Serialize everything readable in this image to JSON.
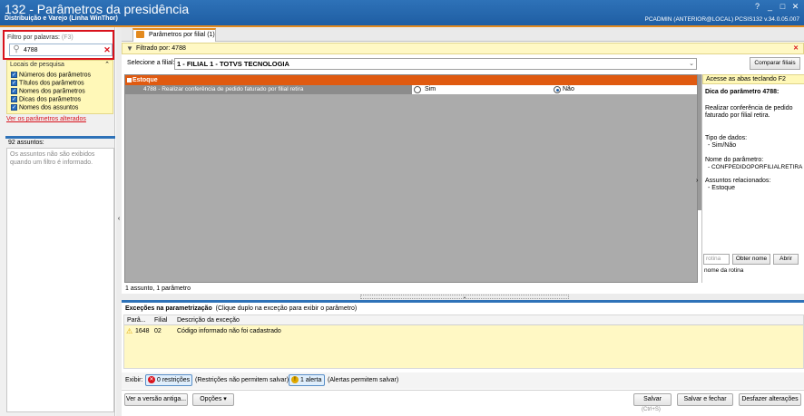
{
  "window": {
    "title": "132 - Parâmetros da presidência",
    "subtitle": "Distribuição e Varejo (Linha WinThor)",
    "user_info": "PCADMIN (ANTERIOR@LOCAL)   PCSIS132  v.34.0.05.007",
    "controls": [
      "?",
      "_",
      "□",
      "✕"
    ]
  },
  "colors": {
    "accent": "#e38a1e",
    "brand_blue": "#1f5ea3",
    "alert_red": "#d9121c",
    "highlight_yellow": "#fff8b8"
  },
  "filter": {
    "label": "Filtro por palavras:",
    "shortcut": "(F3)",
    "value": "4788"
  },
  "search_locations": {
    "title": "Locais de pesquisa",
    "items": [
      "Números dos parâmetros",
      "Títulos dos parâmetros",
      "Nomes dos parâmetros",
      "Dicas dos parâmetros",
      "Nomes dos assuntos"
    ]
  },
  "altered_link": "Ver os parâmetros alterados",
  "subjects": {
    "count": "92 assuntos:",
    "empty_msg": "Os assuntos não são exibidos quando um filtro é informado."
  },
  "tab": {
    "label": "Parâmetros por filial  (1)"
  },
  "filtered": {
    "label": "Filtrado por: 4788"
  },
  "branch": {
    "label": "Selecione a filial:",
    "value": "1 - FILIAL 1 - TOTVS TECNOLOGIA",
    "compare_label": "Comparar filiais"
  },
  "grid": {
    "group": "Estoque",
    "param_label": "4788 - Realizar conferência de pedido faturado por filial retira",
    "option_yes": "Sim",
    "option_no": "Não",
    "selected": "Não"
  },
  "tip": {
    "shortcut": "Acesse as abas teclando F2",
    "title": "Dica do parâmetro 4788:",
    "desc": "Realizar conferência de pedido faturado por filial retira.",
    "type_label": "Tipo de dados:",
    "type_value": "- Sim/Não",
    "name_label": "Nome do parâmetro:",
    "name_value": "- CONFPEDIDOPORFILIALRETIRA",
    "subjects_label": "Assuntos relacionados:",
    "subjects_value": "- Estoque"
  },
  "routine": {
    "placeholder": "rotina",
    "get_name": "Obter nome",
    "open": "Abrir",
    "name_label": "nome da rotina"
  },
  "summary": "1 assunto, 1 parâmetro",
  "exceptions": {
    "title": "Exceções na parametrização",
    "hint": "(Clique duplo na exceção para exibir o parâmetro)",
    "columns": [
      "Parâ...",
      "Filial",
      "Descrição da exceção"
    ],
    "rows": [
      {
        "param": "1648",
        "branch": "02",
        "desc": "Código informado não foi cadastrado"
      }
    ]
  },
  "exibir": {
    "label": "Exibir:",
    "restrictions_btn": "0 restrições",
    "restrictions_note": "(Restrições não permitem salvar)",
    "alerts_btn": "1 alerta",
    "alerts_note": "(Alertas permitem salvar)"
  },
  "buttons": {
    "old_version": "Ver a versão antiga...",
    "options": "Opções",
    "save": "Salvar",
    "save_hint": "(Ctrl+S)",
    "save_close": "Salvar e fechar",
    "undo": "Desfazer alterações"
  }
}
